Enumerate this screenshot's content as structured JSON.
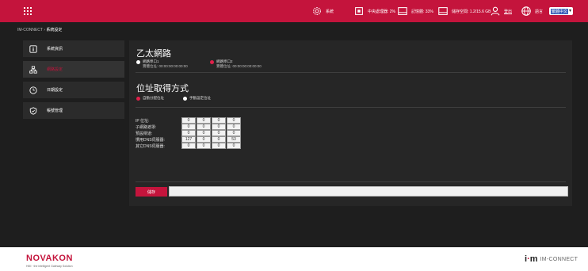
{
  "topbar": {
    "status": [
      {
        "icon": "gear-icon",
        "text": "系統"
      },
      {
        "icon": "cpu-icon",
        "text": "中央處理器: 2%"
      },
      {
        "icon": "memory-icon",
        "text": "記憶體: 33%"
      },
      {
        "icon": "storage-icon",
        "text": "儲存空間: 1.2/15.6 GB"
      },
      {
        "icon": "user-icon",
        "text": "登出"
      },
      {
        "icon": "globe-icon",
        "text": "語言"
      }
    ],
    "language_value": "繁體中文"
  },
  "breadcrumb": {
    "root": "IM-CONNECT",
    "separator": "›",
    "current": "系統設定"
  },
  "sidebar": {
    "items": [
      {
        "label": "系統資訊",
        "icon": "info-icon"
      },
      {
        "label": "網路設定",
        "icon": "network-icon"
      },
      {
        "label": "日期設定",
        "icon": "clock-icon"
      },
      {
        "label": "帳號管理",
        "icon": "shield-icon"
      }
    ]
  },
  "ethernet": {
    "title": "乙太網路",
    "port1_label": "網路埠口1",
    "port1_mac": "實體位址: 00:00:00:00:00:00",
    "port2_label": "網路埠口2",
    "port2_mac": "實體位址: 00:00:00:00:00:00"
  },
  "addressing": {
    "title": "位址取得方式",
    "auto_label": "自動分配位址",
    "manual_label": "手動設定位址"
  },
  "ip_fields": [
    {
      "label": "IP 位址:",
      "octets": [
        "0",
        "0",
        "0",
        "0"
      ]
    },
    {
      "label": "子網路遮罩:",
      "octets": [
        "0",
        "0",
        "0",
        "0"
      ]
    },
    {
      "label": "預設閘道:",
      "octets": [
        "0",
        "0",
        "0",
        "0"
      ]
    },
    {
      "label": "慣用DNS伺服器:",
      "octets": [
        "127",
        "0",
        "0",
        "53"
      ]
    },
    {
      "label": "其它DNS伺服器:",
      "octets": [
        "0",
        "0",
        "0",
        "0"
      ]
    }
  ],
  "actions": {
    "save_label": "儲存",
    "status_text": ""
  },
  "footer": {
    "brand": "NOVAKON",
    "tagline": "HMI · the intelligent Gateway Solution",
    "product": "IM-CONNECT"
  },
  "colors": {
    "accent": "#c4143c",
    "workspace": "#1e1e1e",
    "panel": "#262626"
  }
}
